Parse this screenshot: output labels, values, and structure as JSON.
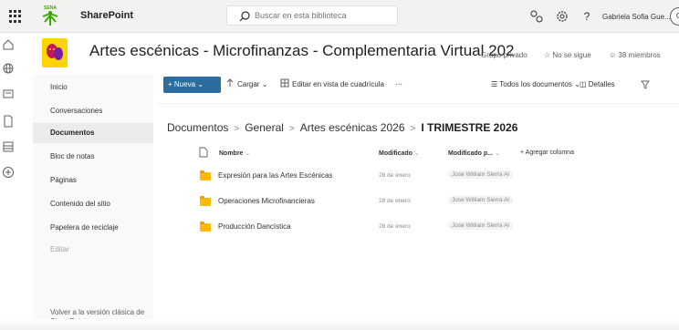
{
  "suite_bar": {
    "app_name": "SharePoint",
    "search_placeholder": "Buscar en esta biblioteca",
    "user_name": "Gabriela Sofia Gue...",
    "avatar_initial": "G"
  },
  "site": {
    "title": "Artes escénicas - Microfinanzas - Complementaria Virtual 202",
    "privacy": "Grupo privado",
    "follow_label": "No se sigue",
    "members_label": "38 miembros"
  },
  "left_nav": {
    "items": [
      {
        "label": "Inicio"
      },
      {
        "label": "Conversaciones"
      },
      {
        "label": "Documentos"
      },
      {
        "label": "Bloc de notas"
      },
      {
        "label": "Páginas"
      },
      {
        "label": "Contenido del sitio"
      },
      {
        "label": "Papelera de reciclaje"
      },
      {
        "label": "Editar"
      }
    ],
    "active_item": "Documentos",
    "classic_link": "Volver a la versión clásica de SharePoint"
  },
  "command_bar": {
    "new_label": "Nueva",
    "upload_label": "Cargar",
    "grid_edit_label": "Editar en vista de cuadrícula",
    "more_label": "···",
    "view_label": "Todos los documentos",
    "details_label": "Detalles"
  },
  "breadcrumb": [
    "Documentos",
    "General",
    "Artes escénicas 2026"
  ],
  "breadcrumb_current": "I TRIMESTRE 2026",
  "table": {
    "columns": {
      "name": "Nombre",
      "modified": "Modificado",
      "modified_by": "Modificado p...",
      "add_column": "Agregar columna"
    },
    "rows": [
      {
        "name": "Expresión para las Artes Escénicas",
        "modified": "28 de enero",
        "modified_by": "Jose William Sierra Al"
      },
      {
        "name": "Operaciones Microfinancieras",
        "modified": "28 de enero",
        "modified_by": "Jose William Sierra Al"
      },
      {
        "name": "Producción Dancística",
        "modified": "28 de enero",
        "modified_by": "Jose William Sierra Al"
      }
    ]
  },
  "colors": {
    "new_button": "#2b6d9e",
    "folder": "#ffb900",
    "nav_active": "#edebe9",
    "site_logo": "#ffd400"
  }
}
